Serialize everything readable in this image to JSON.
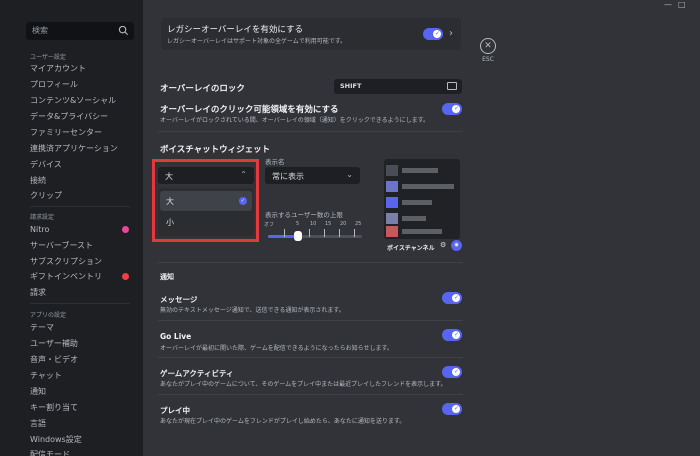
{
  "sidebar": {
    "search_placeholder": "検索",
    "user_settings_header": "ユーザー設定",
    "user_items": [
      "マイアカウント",
      "プロフィール",
      "コンテンツ&ソーシャル",
      "データ&プライバシー",
      "ファミリーセンター",
      "連携済アプリケーション",
      "デバイス",
      "接続",
      "クリップ"
    ],
    "billing_header": "請求設定",
    "billing_items": [
      "Nitro",
      "サーバーブースト",
      "サブスクリプション",
      "ギフトインベントリ",
      "請求"
    ],
    "app_header": "アプリの設定",
    "app_items": [
      "テーマ",
      "ユーザー補助",
      "音声・ビデオ",
      "チャット",
      "通知",
      "キー割り当て",
      "言語",
      "Windows設定",
      "配信モード"
    ]
  },
  "legacy_overlay": {
    "title": "レガシーオーバーレイを有効にする",
    "subtitle": "レガシーオーバーレイはサポート対象の全ゲームで利用可能です。",
    "enabled": true
  },
  "esc": {
    "label": "ESC"
  },
  "overlay_lock": {
    "title": "オーバーレイのロック",
    "key": "SHIFT"
  },
  "clickable_zones": {
    "title": "オーバーレイのクリック可能領域を有効にする",
    "subtitle": "オーバーレイがロックされている間、オーバーレイの領域（通知）をクリックできるようにします。",
    "enabled": true
  },
  "voice_widget": {
    "title": "ボイスチャットウィジェット",
    "size_selected": "大",
    "size_options": [
      "大",
      "小"
    ],
    "display_name_label": "表示名",
    "display_name_value": "常に表示",
    "user_limit_label": "表示するユーザー数の上限",
    "tick_labels": [
      "オフ",
      "5",
      "10",
      "15",
      "20",
      "25"
    ],
    "user_limit_value": "5",
    "preview_label": "ボイスチャンネル"
  },
  "notifications": {
    "header": "通知",
    "items": [
      {
        "title": "メッセージ",
        "subtitle": "無効のテキストメッセージ通知で、送信できる通知が表示されます。",
        "enabled": true
      },
      {
        "title": "Go Live",
        "subtitle": "オーバーレイが最初に開いた際、ゲームを配信できるようになったらお知らせします。",
        "enabled": true
      },
      {
        "title": "ゲームアクティビティ",
        "subtitle": "あなたがプレイ中のゲームについて、そのゲームをプレイ中または最近プレイしたフレンドを表示します。",
        "enabled": true
      },
      {
        "title": "プレイ中",
        "subtitle": "あなたが現在プレイ中のゲームをフレンドがプレイし始めたら、あなたに通知を送ります。",
        "enabled": true
      }
    ]
  },
  "colors": {
    "accent": "#5865f2",
    "highlight_box": "#e03a3e",
    "nitro": "#eb459f",
    "alert": "#f23f43"
  },
  "icons": {
    "search": "search-icon",
    "esc": "close-icon",
    "keyboard": "keyboard-icon",
    "gear": "gear-icon"
  }
}
